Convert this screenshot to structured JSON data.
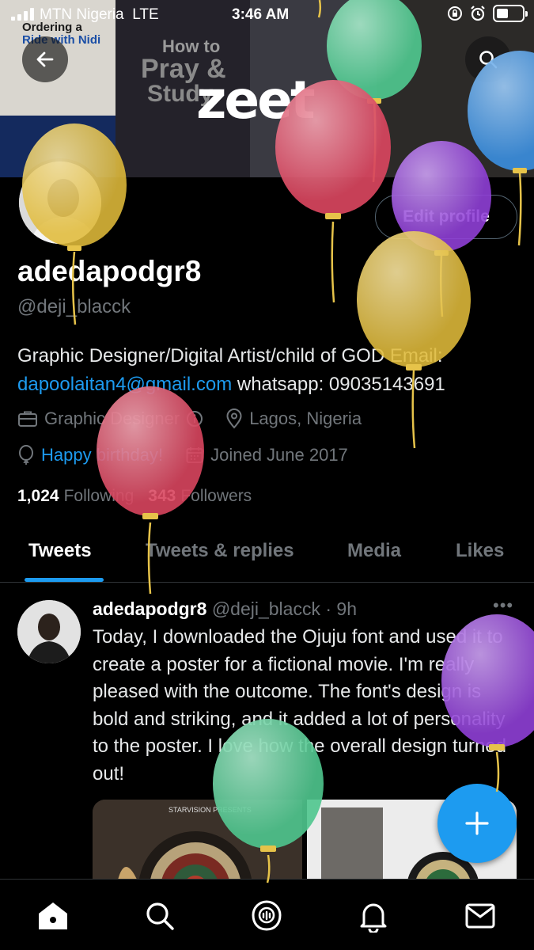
{
  "status_bar": {
    "carrier": "MTN Nigeria",
    "network": "LTE",
    "time": "3:46 AM"
  },
  "banner": {
    "logo_text": "zeet",
    "tile_texts": [
      "Ordering a",
      "Ride with Nidi",
      "How to",
      "Pray &",
      "Study"
    ]
  },
  "header": {
    "back_icon": "arrow-left-icon",
    "search_icon": "search-icon"
  },
  "profile": {
    "edit_button": "Edit profile",
    "display_name": "adedapodgr8",
    "handle": "@deji_blacck",
    "bio_text": "Graphic Designer/Digital Artist/child of GOD Email:",
    "bio_email": "dapoolaitan4@gmail.com",
    "bio_whatsapp": "whatsapp: 09035143691",
    "category": "Graphic Designer",
    "location": "Lagos, Nigeria",
    "birthday": "Happy birthday!",
    "joined": "Joined June 2017",
    "following_count": "1,024",
    "following_label": "Following",
    "followers_count": "343",
    "followers_label": "Followers"
  },
  "tabs": [
    {
      "label": "Tweets",
      "active": true
    },
    {
      "label": "Tweets & replies",
      "active": false
    },
    {
      "label": "Media",
      "active": false
    },
    {
      "label": "Likes",
      "active": false
    }
  ],
  "tweet": {
    "name": "adedapodgr8",
    "handle": "@deji_blacck",
    "separator": "·",
    "age": "9h",
    "more": "•••",
    "text": "Today, I downloaded the Ojuju font and used it to create a poster for a fictional movie. I'm really pleased with the outcome. The font's design is bold and striking, and it added a lot of personality to the poster. I love how the overall design turned out!",
    "media_caption": "STARVISION PRESENTS"
  },
  "fab_icon": "plus-icon",
  "bottom_nav": [
    "home-icon",
    "search-icon",
    "spaces-icon",
    "notifications-icon",
    "messages-icon"
  ],
  "colors": {
    "accent": "#1d9bf0",
    "background": "#000000",
    "muted": "#71767b",
    "balloon_green": "#4fc78e",
    "balloon_red": "#d8455e",
    "balloon_yellow": "#e0bb3a",
    "balloon_purple": "#8f3fd6",
    "balloon_blue": "#3b8fe0"
  }
}
